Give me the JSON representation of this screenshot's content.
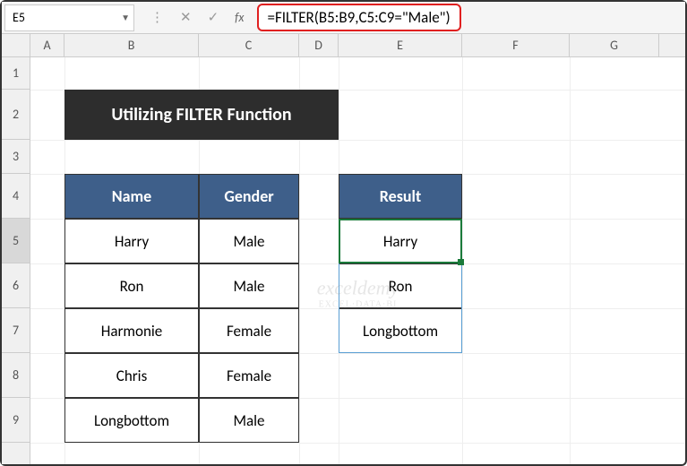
{
  "nameBox": "E5",
  "formula": "=FILTER(B5:B9,C5:C9=\"Male\")",
  "columns": [
    "A",
    "B",
    "C",
    "D",
    "E",
    "F",
    "G"
  ],
  "rows": [
    "1",
    "2",
    "3",
    "4",
    "5",
    "6",
    "7",
    "8",
    "9"
  ],
  "title": "Utilizing FILTER Function",
  "table1": {
    "headers": {
      "name": "Name",
      "gender": "Gender"
    },
    "rows": [
      {
        "name": "Harry",
        "gender": "Male"
      },
      {
        "name": "Ron",
        "gender": "Male"
      },
      {
        "name": "Harmonie",
        "gender": "Female"
      },
      {
        "name": "Chris",
        "gender": "Female"
      },
      {
        "name": "Longbottom",
        "gender": "Male"
      }
    ]
  },
  "table2": {
    "header": "Result",
    "rows": [
      "Harry",
      "Ron",
      "Longbottom"
    ]
  },
  "watermark": {
    "main": "exceldemy",
    "sub": "EXCEL·DATA·BI"
  }
}
